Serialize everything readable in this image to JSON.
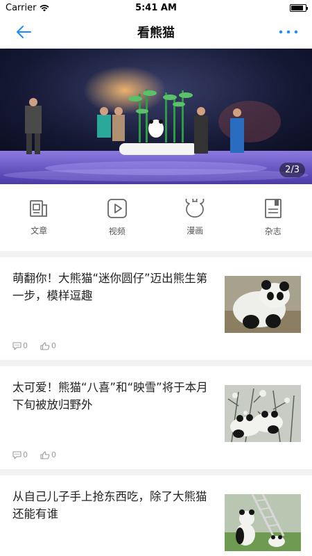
{
  "status_bar": {
    "carrier": "Carrier",
    "time": "5:41 AM",
    "battery_level": 0.85
  },
  "nav": {
    "title": "看熊猫",
    "back_icon": "back-arrow-icon",
    "more_icon": "more-dots-icon"
  },
  "banner": {
    "page_indicator": "2/3"
  },
  "categories": [
    {
      "label": "文章",
      "icon": "article-icon"
    },
    {
      "label": "视频",
      "icon": "video-play-icon"
    },
    {
      "label": "漫画",
      "icon": "panda-face-icon"
    },
    {
      "label": "杂志",
      "icon": "magazine-icon"
    }
  ],
  "articles": [
    {
      "title": "萌翻你！大熊猫“迷你圆仔”迈出熊生第一步，模样逗趣",
      "comments": "0",
      "likes": "0"
    },
    {
      "title": "太可爱！熊猫“八喜”和“映雪”将于本月下旬被放归野外",
      "comments": "0",
      "likes": "0"
    },
    {
      "title": "从自己儿子手上抢东西吃，除了大熊猫还能有谁"
    }
  ],
  "colors": {
    "accent": "#1a8cff"
  }
}
